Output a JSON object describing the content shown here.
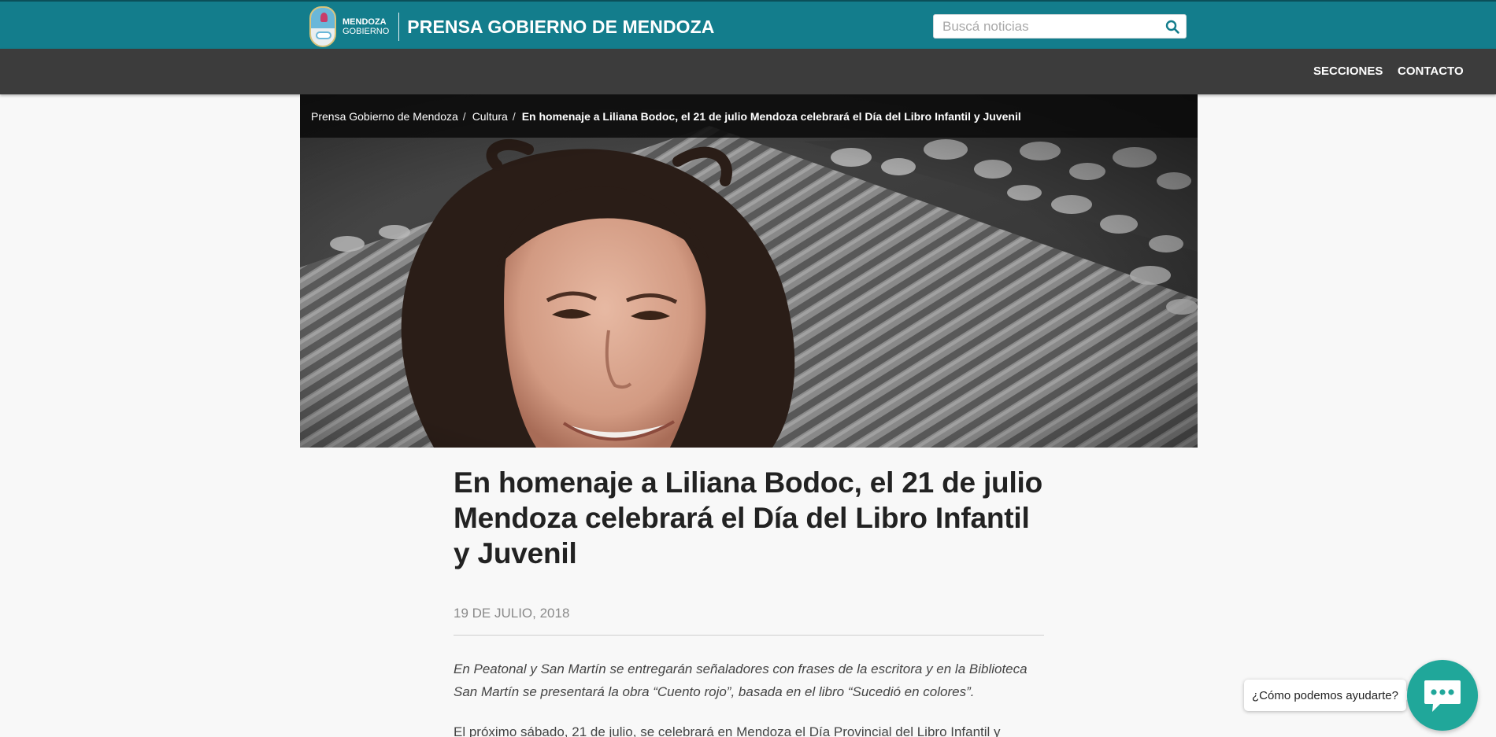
{
  "header": {
    "logo_line1": "MENDOZA",
    "logo_line2": "GOBIERNO",
    "site_title": "PRENSA GOBIERNO DE MENDOZA",
    "search_placeholder": "Buscá noticias",
    "search_icon": "search-icon",
    "brand_color": "#137d8c"
  },
  "nav": {
    "items": [
      {
        "label": "SECCIONES"
      },
      {
        "label": "CONTACTO"
      }
    ],
    "background": "#3c3c3c"
  },
  "breadcrumb": {
    "items": [
      {
        "label": "Prensa Gobierno de Mendoza"
      },
      {
        "label": "Cultura"
      },
      {
        "label": "En homenaje a Liliana Bodoc, el 21 de julio Mendoza celebrará el Día del Libro Infantil y Juvenil"
      }
    ],
    "separator": "/"
  },
  "article": {
    "headline": "En homenaje a Liliana Bodoc, el 21 de julio Mendoza celebrará el Día del Libro Infantil y Juvenil",
    "date": "19 DE JULIO, 2018",
    "lead": "En Peatonal y San Martín se entregarán señaladores con frases de la escritora y en la Biblioteca San Martín se presentará la obra “Cuento rojo”, basada en el libro “Sucedió en colores”.",
    "body_start": "El próximo sábado, 21 de julio, se celebrará en Mendoza el Día Provincial del Libro Infantil y"
  },
  "chat": {
    "tooltip": "¿Cómo podemos ayudarte?",
    "icon": "chat-bubble-icon",
    "color": "#20a79a"
  }
}
